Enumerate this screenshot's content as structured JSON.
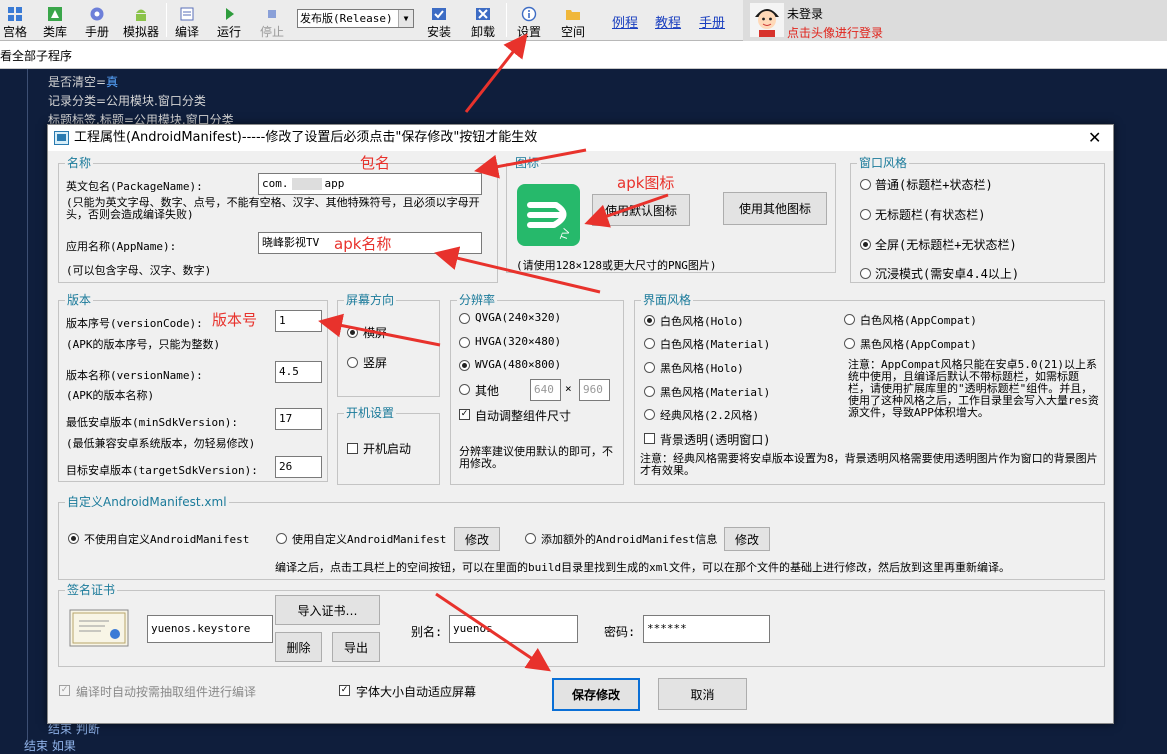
{
  "toolbar": {
    "items": [
      {
        "label": "宫格",
        "icon": "grid-icon"
      },
      {
        "label": "类库",
        "icon": "library-icon"
      },
      {
        "label": "手册",
        "icon": "manual-icon"
      },
      {
        "label": "模拟器",
        "icon": "android-icon"
      },
      {
        "label": "编译",
        "icon": "compile-icon"
      },
      {
        "label": "运行",
        "icon": "run-icon"
      },
      {
        "label": "停止",
        "icon": "stop-icon"
      },
      {
        "label": "安装",
        "icon": "install-icon"
      },
      {
        "label": "卸载",
        "icon": "uninstall-icon"
      },
      {
        "label": "设置",
        "icon": "info-icon"
      },
      {
        "label": "空间",
        "icon": "folder-icon"
      }
    ],
    "release_select": "发布版(Release)",
    "links": [
      "例程",
      "教程",
      "手册"
    ],
    "user": {
      "status": "未登录",
      "hint": "点击头像进行登录"
    }
  },
  "subbar": {
    "text": "看全部子程序"
  },
  "code": {
    "lines": [
      {
        "a": "是否清空=",
        "b": "真"
      },
      {
        "a": "记录分类=公用模块.窗口分类",
        "b": ""
      },
      {
        "a": "标题标签.标题=公用模块.窗口分类",
        "b": ""
      }
    ],
    "bottom_lines": [
      "结束 判断",
      "结束 如果"
    ]
  },
  "dialog": {
    "title": "工程属性(AndroidManifest)-----修改了设置后必须点击\"保存修改\"按钮才能生效",
    "name_group": {
      "title": "名称",
      "package_label": "英文包名(PackageName):",
      "package_prefix": "com.",
      "package_suffix": "app",
      "package_note": "(只能为英文字母、数字、点号，不能有空格、汉字、其他特殊符号，且必须以字母开头，否则会造成编译失败)",
      "app_label": "应用名称(AppName):",
      "app_value": "晓峰影视TV",
      "app_note": "(可以包含字母、汉字、数字)"
    },
    "icon_group": {
      "title": "图标",
      "default_btn": "使用默认图标",
      "other_btn": "使用其他图标",
      "note": "(请使用128×128或更大尺寸的PNG图片)"
    },
    "window_group": {
      "title": "窗口风格",
      "options": [
        "普通(标题栏+状态栏)",
        "无标题栏(有状态栏)",
        "全屏(无标题栏+无状态栏)",
        "沉浸模式(需安卓4.4以上)"
      ],
      "selected": 2
    },
    "version_group": {
      "title": "版本",
      "code_label": "版本序号(versionCode):",
      "code_value": "1",
      "code_note": "(APK的版本序号，只能为整数)",
      "name_label": "版本名称(versionName):",
      "name_value": "4.5",
      "name_note": "(APK的版本名称)",
      "min_label": "最低安卓版本(minSdkVersion):",
      "min_value": "17",
      "min_note": "(最低兼容安卓系统版本，勿轻易修改)",
      "target_label": "目标安卓版本(targetSdkVersion):",
      "target_value": "26"
    },
    "orient_group": {
      "title": "屏幕方向",
      "options": [
        "横屏",
        "竖屏"
      ],
      "selected": 0
    },
    "boot_group": {
      "title": "开机设置",
      "option": "开机启动"
    },
    "res_group": {
      "title": "分辨率",
      "options": [
        "QVGA(240×320)",
        "HVGA(320×480)",
        "WVGA(480×800)",
        "其他"
      ],
      "selected": 2,
      "w": "640",
      "x": "×",
      "h": "960",
      "auto": "自动调整组件尺寸",
      "note": "分辨率建议使用默认的即可，不用修改。"
    },
    "ui_group": {
      "title": "界面风格",
      "left": [
        "白色风格(Holo)",
        "白色风格(Material)",
        "黑色风格(Holo)",
        "黑色风格(Material)",
        "经典风格(2.2风格)"
      ],
      "right": [
        "白色风格(AppCompat)",
        "黑色风格(AppCompat)"
      ],
      "selected": 0,
      "note1": "注意：AppCompat风格只能在安卓5.0(21)以上系统中使用，且编译后默认不带标题栏，如需标题栏，请使用扩展库里的\"透明标题栏\"组件。并且，使用了这种风格之后，工作目录里会写入大量res资源文件，导致APP体积增大。",
      "transparent": "背景透明(透明窗口)",
      "note2": "注意：经典风格需要将安卓版本设置为8，背景透明风格需要使用透明图片作为窗口的背景图片才有效果。"
    },
    "manifest_group": {
      "title": "自定义AndroidManifest.xml",
      "options": [
        "不使用自定义AndroidManifest",
        "使用自定义AndroidManifest",
        "添加额外的AndroidManifest信息"
      ],
      "selected": 0,
      "edit1": "修改",
      "edit2": "修改",
      "note": "编译之后，点击工具栏上的空间按钮，可以在里面的build目录里找到生成的xml文件，可以在那个文件的基础上进行修改，然后放到这里再重新编译。"
    },
    "sign_group": {
      "title": "签名证书",
      "keystore": "yuenos.keystore",
      "import_btn": "导入证书…",
      "delete_btn": "删除",
      "export_btn": "导出",
      "alias_label": "别名:",
      "alias_value": "yuenos",
      "pwd_label": "密码:",
      "pwd_value": "******"
    },
    "auto_compile": "编译时自动按需抽取组件进行编译",
    "font_auto": "字体大小自动适应屏幕",
    "save_btn": "保存修改",
    "cancel_btn": "取消"
  },
  "annotations": {
    "pkg": "包名",
    "icon": "apk图标",
    "appname": "apk名称",
    "version": "版本号"
  },
  "colors": {
    "annotation": "#e8322c",
    "group_title": "#1a7a9a",
    "link": "#1a3fbf",
    "code_bg": "#0f1e3c"
  }
}
